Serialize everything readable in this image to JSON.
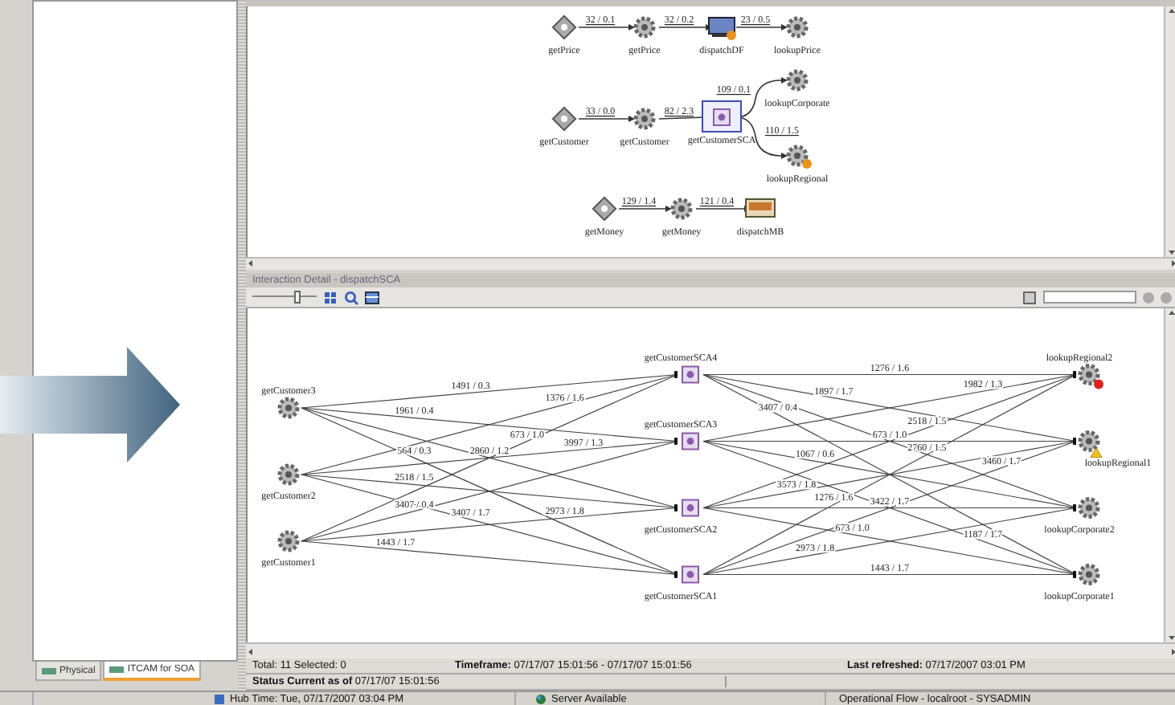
{
  "left_panel": {
    "tabs": [
      {
        "label": "Physical",
        "selected": false
      },
      {
        "label": "ITCAM for SOA",
        "selected": true
      }
    ]
  },
  "top_flow": {
    "nodes": [
      {
        "label": "getPrice",
        "kind": "unknown",
        "selected": false,
        "warning": false
      },
      {
        "label": "getPrice",
        "kind": "service",
        "selected": false,
        "warning": false
      },
      {
        "label": "dispatchDF",
        "kind": "screen",
        "selected": false,
        "warning": true
      },
      {
        "label": "lookupPrice",
        "kind": "service",
        "selected": false,
        "warning": false
      },
      {
        "label": "getCustomer",
        "kind": "unknown",
        "selected": false,
        "warning": false
      },
      {
        "label": "getCustomer",
        "kind": "service",
        "selected": false,
        "warning": false
      },
      {
        "label": "getCustomerSCA",
        "kind": "sca",
        "selected": true,
        "warning": false
      },
      {
        "label": "lookupCorporate",
        "kind": "service",
        "selected": false,
        "warning": false
      },
      {
        "label": "lookupRegional",
        "kind": "service",
        "selected": false,
        "warning": true
      },
      {
        "label": "getMoney",
        "kind": "unknown",
        "selected": false,
        "warning": false
      },
      {
        "label": "getMoney",
        "kind": "service",
        "selected": false,
        "warning": false
      },
      {
        "label": "dispatchMB",
        "kind": "inbox",
        "selected": false,
        "warning": false
      }
    ],
    "edge_labels": [
      "32 / 0.1",
      "32 / 0.2",
      "23 / 0.5",
      "33 / 0.0",
      "82 / 2.3",
      "109 / 0.1",
      "110 / 1.5",
      "129 / 1.4",
      "121 / 0.4"
    ]
  },
  "detail": {
    "title": "Interaction Detail - dispatchSCA",
    "toolbar": {
      "zoom_slider": {
        "level": 0.7
      }
    },
    "columns": [
      [
        {
          "label": "getCustomer3",
          "kind": "service",
          "warning": false,
          "error": false
        },
        {
          "label": "getCustomer2",
          "kind": "service",
          "warning": false,
          "error": false
        },
        {
          "label": "getCustomer1",
          "kind": "service",
          "warning": false,
          "error": false
        }
      ],
      [
        {
          "label": "getCustomerSCA4",
          "kind": "sca",
          "warning": false,
          "error": false
        },
        {
          "label": "getCustomerSCA3",
          "kind": "sca",
          "warning": false,
          "error": false
        },
        {
          "label": "getCustomerSCA2",
          "kind": "sca",
          "warning": false,
          "error": false
        },
        {
          "label": "getCustomerSCA1",
          "kind": "sca",
          "warning": false,
          "error": false
        }
      ],
      [
        {
          "label": "lookupRegional2",
          "kind": "service",
          "warning": false,
          "error": true
        },
        {
          "label": "lookupRegional1",
          "kind": "service",
          "warning": true,
          "error": false
        },
        {
          "label": "lookupCorporate2",
          "kind": "service",
          "warning": false,
          "error": false
        },
        {
          "label": "lookupCorporate1",
          "kind": "service",
          "warning": false,
          "error": false
        }
      ]
    ],
    "left_edge_labels": [
      "1491 / 0.3",
      "1961 / 0.4",
      "2860 / 1.2",
      "564 / 0.3",
      "1376 / 1.6",
      "3997 / 1.3",
      "2518 / 1.5",
      "3407 / 1.7",
      "673 / 1.0",
      "3407 / 0.4",
      "2973 / 1.8",
      "1443 / 1.7"
    ],
    "right_edge_labels": [
      "1276 / 1.6",
      "1897 / 1.7",
      "2760 / 1.5",
      "3407 / 0.4",
      "1982 / 1.3",
      "673 / 1.0",
      "1067 / 0.6",
      "1187 / 1.7",
      "2518 / 1.5",
      "3573 / 1.8",
      "3422 / 1.7",
      "673 / 1.0",
      "1276 / 1.6",
      "3460 / 1.7",
      "2973 / 1.8",
      "1443 / 1.7"
    ]
  },
  "status": {
    "total": "Total: 11 Selected: 0",
    "timeframe": "**Timeframe:** 07/17/07 15:01:56 - 07/17/07 15:01:56",
    "last_refreshed": "**Last refreshed:** 07/17/2007 03:01 PM",
    "current": "**Status Current as of** 07/17/07 15:01:56"
  },
  "status_bar": {
    "hub_time": "Hub Time: Tue, 07/17/2007 03:04 PM",
    "server": "Server Available",
    "context": "Operational Flow - localroot - SYSADMIN"
  }
}
